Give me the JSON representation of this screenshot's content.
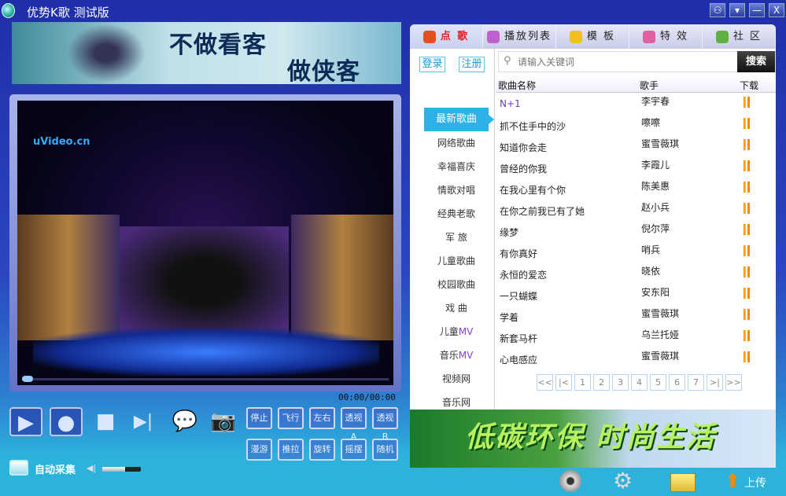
{
  "window": {
    "title": "优势K歌  测试版",
    "buttons": [
      "skin",
      "menu",
      "minimize",
      "close"
    ],
    "button_glyphs": [
      "⚇",
      "▾",
      "—",
      "X"
    ]
  },
  "banner": {
    "line1": "不做看客",
    "line2": "做侠客"
  },
  "video": {
    "watermark": "uVideo.cn",
    "time": "00:00/00:00",
    "progress": 0
  },
  "controls": {
    "fx_row1": [
      "停止",
      "飞行",
      "左右",
      "透视A",
      "透视B"
    ],
    "fx_row2": [
      "漫游",
      "推拉",
      "旋转",
      "摇摆",
      "随机"
    ],
    "auto_collect": "自动采集",
    "volume": 0.6
  },
  "tabs": [
    {
      "label": "点 歌",
      "active": true,
      "color": "#e05020"
    },
    {
      "label": "播放列表",
      "color": "#c060d0"
    },
    {
      "label": "模 板",
      "color": "#f0c020"
    },
    {
      "label": "特 效",
      "color": "#e060a0"
    },
    {
      "label": "社 区",
      "color": "#60b040"
    }
  ],
  "auth": {
    "login": "登录",
    "register": "注册"
  },
  "categories": [
    "最新歌曲",
    "网络歌曲",
    "幸福喜庆",
    "情歌对唱",
    "经典老歌",
    "军 旅",
    "儿童歌曲",
    "校园歌曲",
    "戏 曲"
  ],
  "mv_categories": [
    {
      "prefix": "儿童",
      "suffix": "MV"
    },
    {
      "prefix": "音乐",
      "suffix": "MV"
    }
  ],
  "extra_categories": [
    "视频网",
    "音乐网"
  ],
  "search": {
    "placeholder": "请输入关键词",
    "button": "搜索"
  },
  "table": {
    "headers": [
      "歌曲名称",
      "歌手",
      "下载"
    ],
    "rows": [
      [
        "N+1",
        "李宇春"
      ],
      [
        "抓不住手中的沙",
        "嚓嚓"
      ],
      [
        "知道你会走",
        "蜜雪薇琪"
      ],
      [
        "曾经的你我",
        "李霞儿"
      ],
      [
        "在我心里有个你",
        "陈美惠"
      ],
      [
        "在你之前我已有了她",
        "赵小兵"
      ],
      [
        "缘梦",
        "倪尔萍"
      ],
      [
        "有你真好",
        "哨兵"
      ],
      [
        "永恒的爱恋",
        "晓依"
      ],
      [
        "一只蝴蝶",
        "安东阳"
      ],
      [
        "学着",
        "蜜雪薇琪"
      ],
      [
        "新套马杆",
        "乌兰托娅"
      ],
      [
        "心电感应",
        "蜜雪薇琪"
      ]
    ]
  },
  "pager": [
    "<<",
    "|<",
    "1",
    "2",
    "3",
    "4",
    "5",
    "6",
    "7",
    ">|",
    ">>"
  ],
  "ad": {
    "text": "低碳环保 时尚生活"
  },
  "bottombar": {
    "upload": "上传"
  }
}
